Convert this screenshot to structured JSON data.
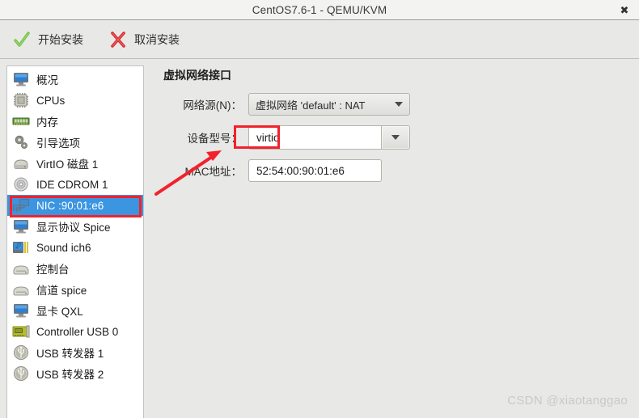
{
  "window": {
    "title": "CentOS7.6-1 - QEMU/KVM",
    "close_label": "✖"
  },
  "toolbar": {
    "begin_install_label": "开始安装",
    "begin_install_icon": "green-check-icon",
    "cancel_install_label": "取消安装",
    "cancel_install_icon": "red-x-icon"
  },
  "sidebar": {
    "items": [
      {
        "label": "概况",
        "icon": "monitor-icon",
        "selected": false
      },
      {
        "label": "CPUs",
        "icon": "cpu-chip-icon",
        "selected": false
      },
      {
        "label": "内存",
        "icon": "memory-icon",
        "selected": false
      },
      {
        "label": "引导选项",
        "icon": "gears-icon",
        "selected": false
      },
      {
        "label": "VirtIO 磁盘 1",
        "icon": "harddisk-icon",
        "selected": false
      },
      {
        "label": "IDE CDROM 1",
        "icon": "cdrom-icon",
        "selected": false
      },
      {
        "label": "NIC :90:01:e6",
        "icon": "network-icon",
        "selected": true
      },
      {
        "label": "显示协议  Spice",
        "icon": "display-icon",
        "selected": false
      },
      {
        "label": "Sound ich6",
        "icon": "sound-icon",
        "selected": false
      },
      {
        "label": "控制台",
        "icon": "console-icon",
        "selected": false
      },
      {
        "label": "信道  spice",
        "icon": "channel-icon",
        "selected": false
      },
      {
        "label": "显卡  QXL",
        "icon": "videocard-icon",
        "selected": false
      },
      {
        "label": "Controller USB 0",
        "icon": "controller-card-icon",
        "selected": false
      },
      {
        "label": "USB 转发器 1",
        "icon": "usb-icon",
        "selected": false
      },
      {
        "label": "USB 转发器 2",
        "icon": "usb-icon",
        "selected": false
      }
    ]
  },
  "main": {
    "heading": "虚拟网络接口",
    "network_source": {
      "label": "网络源(N)：",
      "value": "虚拟网络  'default' : NAT"
    },
    "device_model": {
      "label": "设备型号：",
      "value": "virtio"
    },
    "mac_address": {
      "label": "MAC地址：",
      "value": "52:54:00:90:01:e6"
    }
  },
  "annotations": {
    "highlight_color": "#f2212c",
    "arrow_color": "#f2212c"
  },
  "watermark": {
    "text": "CSDN @xiaotanggao"
  }
}
